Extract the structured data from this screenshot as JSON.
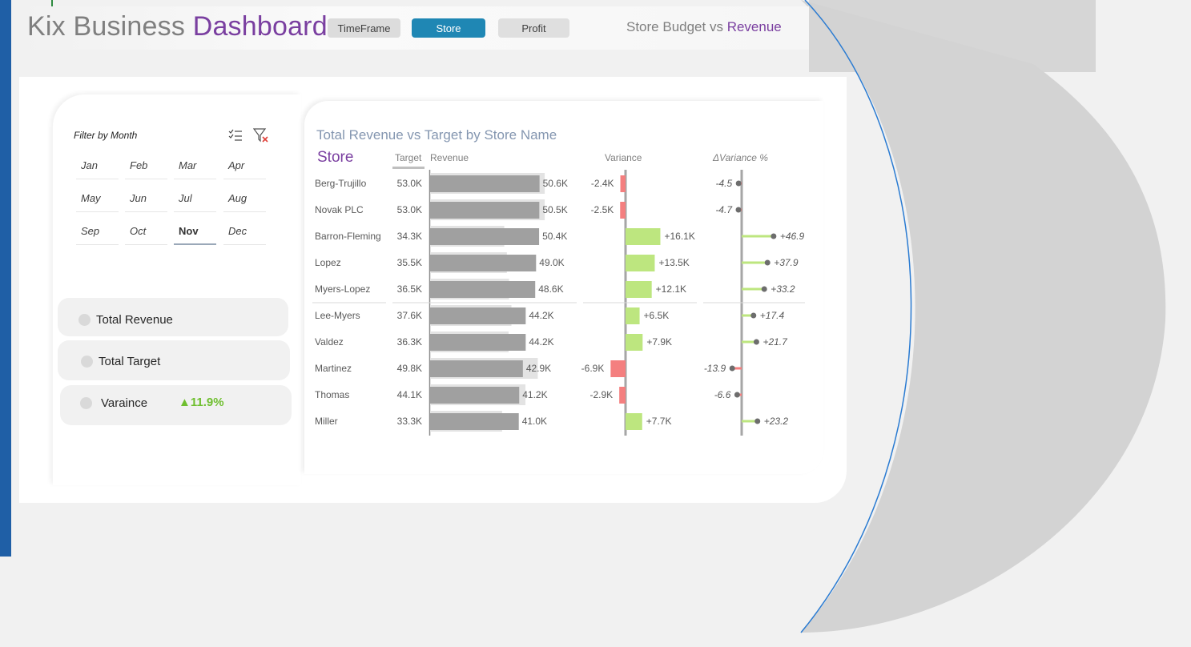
{
  "header": {
    "title_main": "Kix Business ",
    "title_accent": "Dashboard",
    "nav": [
      {
        "label": "TimeFrame",
        "active": false
      },
      {
        "label": "Store",
        "active": true
      },
      {
        "label": "Profit",
        "active": false
      }
    ],
    "subtitle_main": "Store Budget vs ",
    "subtitle_accent": "Revenue"
  },
  "colors": {
    "accent_purple": "#7a3fa0",
    "nav_active": "#1f87b4",
    "left_strip": "#1f5fa6",
    "bar_gray": "#a0a0a0",
    "target_gray": "#e3e3e3",
    "positive": "#bde67f",
    "negative": "#f47f7f",
    "kpi_positive": "#6fbf2f"
  },
  "filter": {
    "title": "Filter by Month",
    "icons": [
      "multi-select-icon",
      "clear-filter-icon"
    ],
    "months": [
      "Jan",
      "Feb",
      "Mar",
      "Apr",
      "May",
      "Jun",
      "Jul",
      "Aug",
      "Sep",
      "Oct",
      "Nov",
      "Dec"
    ],
    "selected": "Nov"
  },
  "kpis": [
    {
      "label": "Total Revenue",
      "value": ""
    },
    {
      "label": "Total Target",
      "value": ""
    },
    {
      "label": "Varaince",
      "value": "▲11.9%"
    }
  ],
  "chart_data": {
    "type": "table",
    "title": "Total Revenue vs Target by Store Name",
    "columns": {
      "store": "Store",
      "target": "Target",
      "revenue": "Revenue",
      "variance": "Variance",
      "variance_pct": "ΔVariance %"
    },
    "rows": [
      {
        "store": "Berg-Trujillo",
        "target": 53.0,
        "revenue": 50.6,
        "variance": -2.4,
        "variance_pct": -4.5,
        "target_label": "53.0K",
        "revenue_label": "50.6K",
        "variance_label": "-2.4K",
        "pct_label": "-4.5"
      },
      {
        "store": "Novak PLC",
        "target": 53.0,
        "revenue": 50.5,
        "variance": -2.5,
        "variance_pct": -4.7,
        "target_label": "53.0K",
        "revenue_label": "50.5K",
        "variance_label": "-2.5K",
        "pct_label": "-4.7"
      },
      {
        "store": "Barron-Fleming",
        "target": 34.3,
        "revenue": 50.4,
        "variance": 16.1,
        "variance_pct": 46.9,
        "target_label": "34.3K",
        "revenue_label": "50.4K",
        "variance_label": "+16.1K",
        "pct_label": "+46.9"
      },
      {
        "store": "Lopez",
        "target": 35.5,
        "revenue": 49.0,
        "variance": 13.5,
        "variance_pct": 37.9,
        "target_label": "35.5K",
        "revenue_label": "49.0K",
        "variance_label": "+13.5K",
        "pct_label": "+37.9"
      },
      {
        "store": "Myers-Lopez",
        "target": 36.5,
        "revenue": 48.6,
        "variance": 12.1,
        "variance_pct": 33.2,
        "target_label": "36.5K",
        "revenue_label": "48.6K",
        "variance_label": "+12.1K",
        "pct_label": "+33.2"
      },
      {
        "store": "Lee-Myers",
        "target": 37.6,
        "revenue": 44.2,
        "variance": 6.5,
        "variance_pct": 17.4,
        "target_label": "37.6K",
        "revenue_label": "44.2K",
        "variance_label": "+6.5K",
        "pct_label": "+17.4"
      },
      {
        "store": "Valdez",
        "target": 36.3,
        "revenue": 44.2,
        "variance": 7.9,
        "variance_pct": 21.7,
        "target_label": "36.3K",
        "revenue_label": "44.2K",
        "variance_label": "+7.9K",
        "pct_label": "+21.7"
      },
      {
        "store": "Martinez",
        "target": 49.8,
        "revenue": 42.9,
        "variance": -6.9,
        "variance_pct": -13.9,
        "target_label": "49.8K",
        "revenue_label": "42.9K",
        "variance_label": "-6.9K",
        "pct_label": "-13.9"
      },
      {
        "store": "Thomas",
        "target": 44.1,
        "revenue": 41.2,
        "variance": -2.9,
        "variance_pct": -6.6,
        "target_label": "44.1K",
        "revenue_label": "41.2K",
        "variance_label": "-2.9K",
        "pct_label": "-6.6"
      },
      {
        "store": "Miller",
        "target": 33.3,
        "revenue": 41.0,
        "variance": 7.7,
        "variance_pct": 23.2,
        "target_label": "33.3K",
        "revenue_label": "41.0K",
        "variance_label": "+7.7K",
        "pct_label": "+23.2"
      }
    ]
  }
}
